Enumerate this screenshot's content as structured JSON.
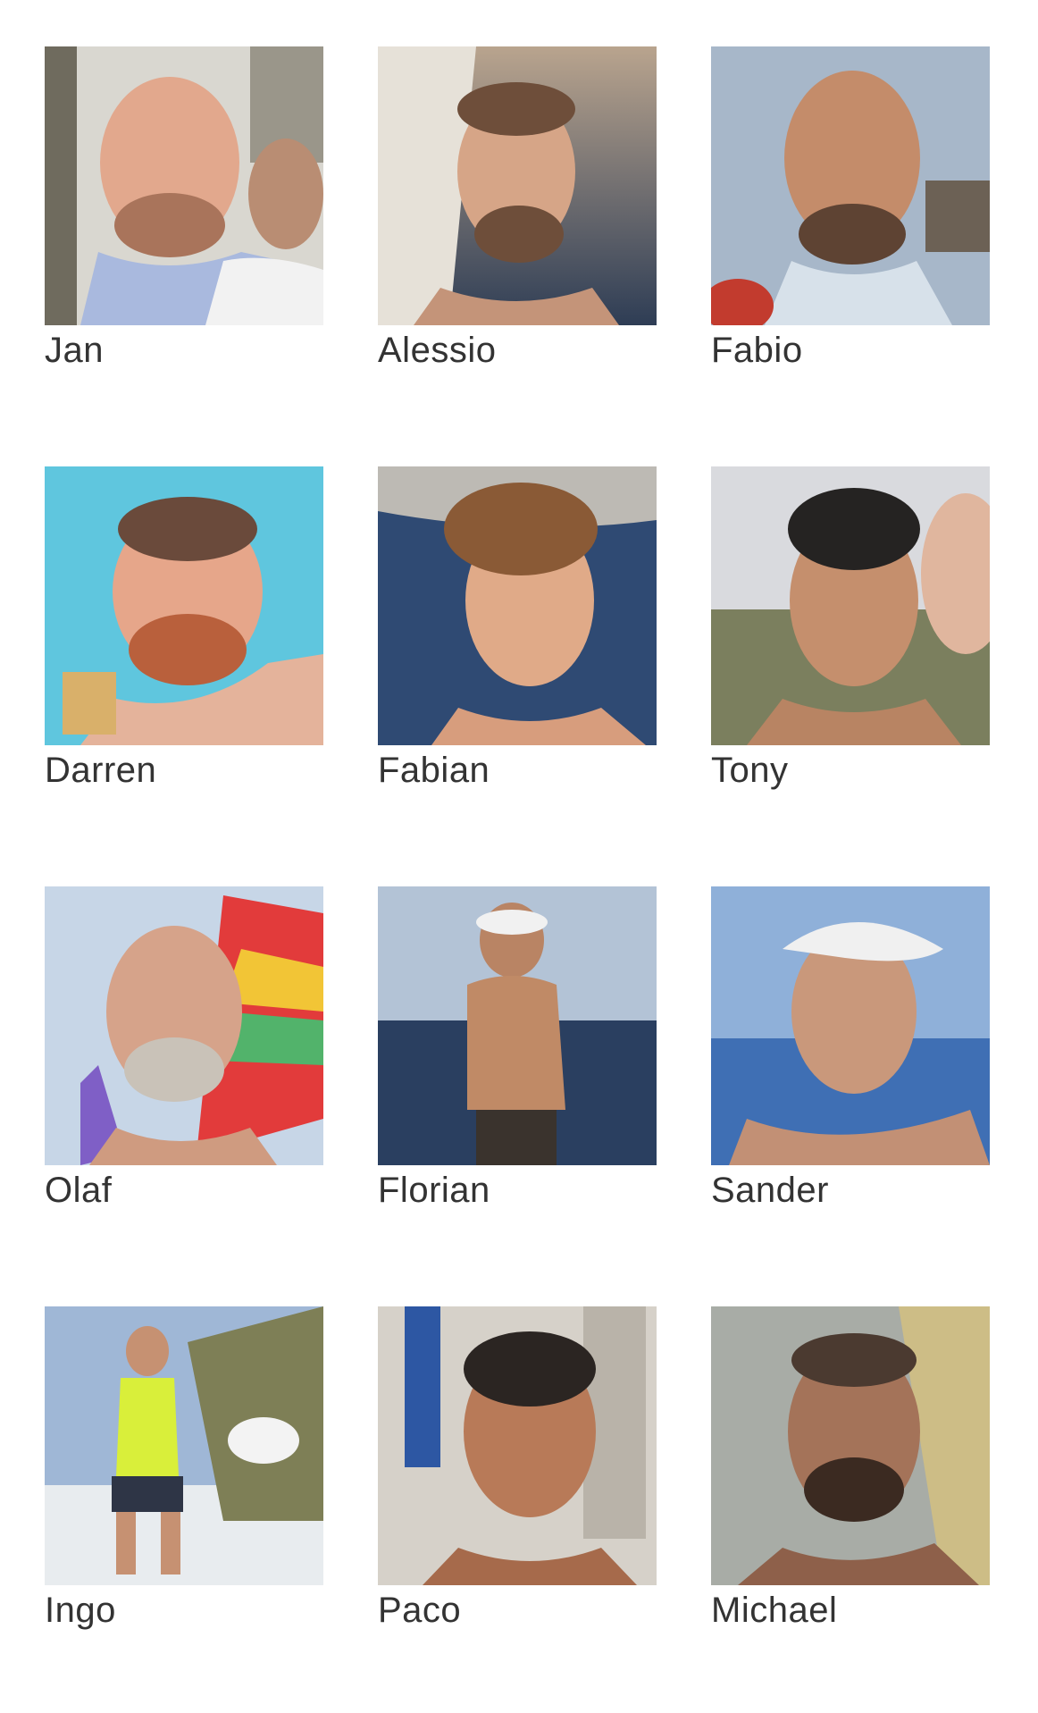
{
  "team": {
    "members": [
      {
        "name": "Jan",
        "photo_icon": "portrait-photo-icon"
      },
      {
        "name": "Alessio",
        "photo_icon": "portrait-photo-icon"
      },
      {
        "name": "Fabio",
        "photo_icon": "portrait-photo-icon"
      },
      {
        "name": "Darren",
        "photo_icon": "portrait-photo-icon"
      },
      {
        "name": "Fabian",
        "photo_icon": "portrait-photo-icon"
      },
      {
        "name": "Tony",
        "photo_icon": "portrait-photo-icon"
      },
      {
        "name": "Olaf",
        "photo_icon": "portrait-photo-icon"
      },
      {
        "name": "Florian",
        "photo_icon": "portrait-photo-icon"
      },
      {
        "name": "Sander",
        "photo_icon": "portrait-photo-icon"
      },
      {
        "name": "Ingo",
        "photo_icon": "portrait-photo-icon"
      },
      {
        "name": "Paco",
        "photo_icon": "portrait-photo-icon"
      },
      {
        "name": "Michael",
        "photo_icon": "portrait-photo-icon"
      }
    ]
  },
  "colors": {
    "text": "#333333",
    "background": "#ffffff"
  }
}
